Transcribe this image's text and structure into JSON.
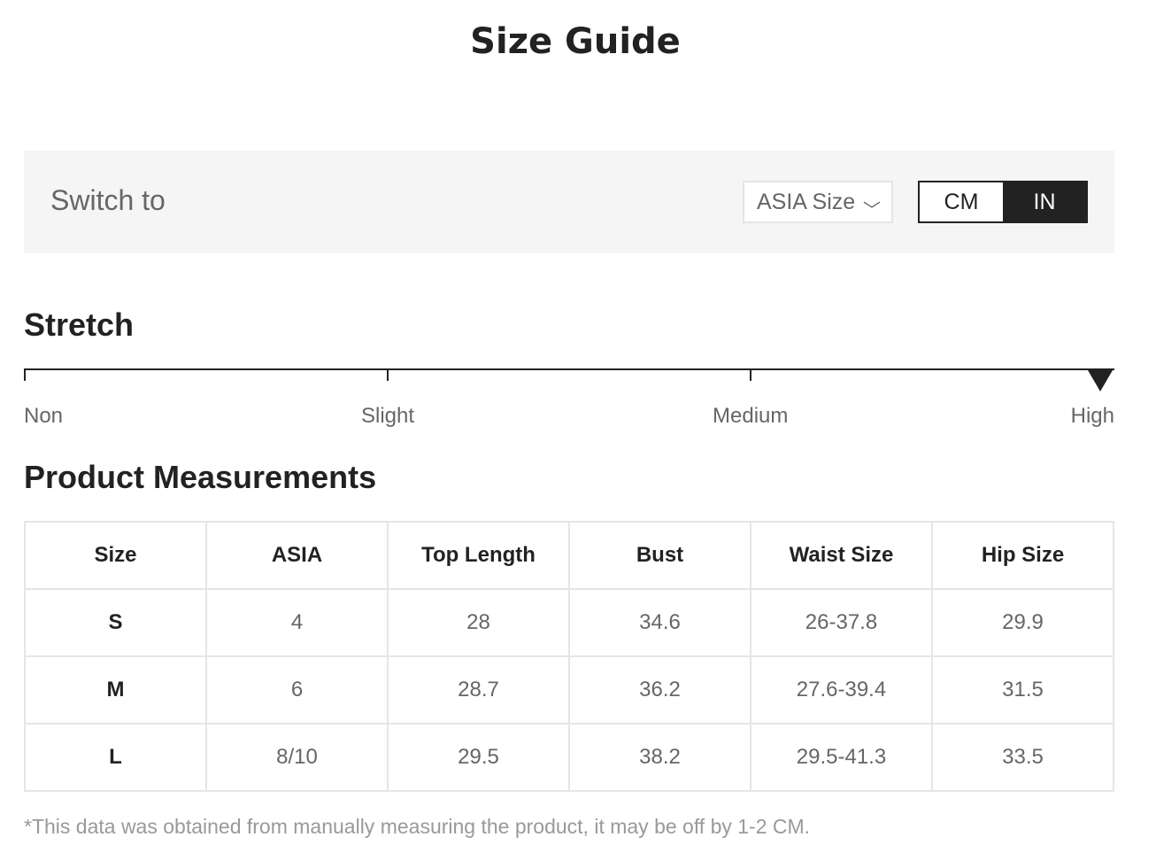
{
  "title": "Size Guide",
  "switch_bar": {
    "label": "Switch to",
    "size_system": "ASIA Size",
    "units": [
      "CM",
      "IN"
    ],
    "active_unit": "IN"
  },
  "stretch": {
    "heading": "Stretch",
    "levels": [
      "Non",
      "Slight",
      "Medium",
      "High"
    ],
    "selected": "High"
  },
  "measurements": {
    "heading": "Product Measurements",
    "columns": [
      "Size",
      "ASIA",
      "Top Length",
      "Bust",
      "Waist Size",
      "Hip Size"
    ],
    "rows": [
      [
        "S",
        "4",
        "28",
        "34.6",
        "26-37.8",
        "29.9"
      ],
      [
        "M",
        "6",
        "28.7",
        "36.2",
        "27.6-39.4",
        "31.5"
      ],
      [
        "L",
        "8/10",
        "29.5",
        "38.2",
        "29.5-41.3",
        "33.5"
      ]
    ]
  },
  "footnote": "*This data was obtained from manually measuring the product, it may be off by 1-2 CM.",
  "colors": {
    "text": "#222222",
    "muted": "#666666",
    "footnote": "#999999",
    "bar_background": "#f5f5f5",
    "border": "#e5e5e5"
  }
}
